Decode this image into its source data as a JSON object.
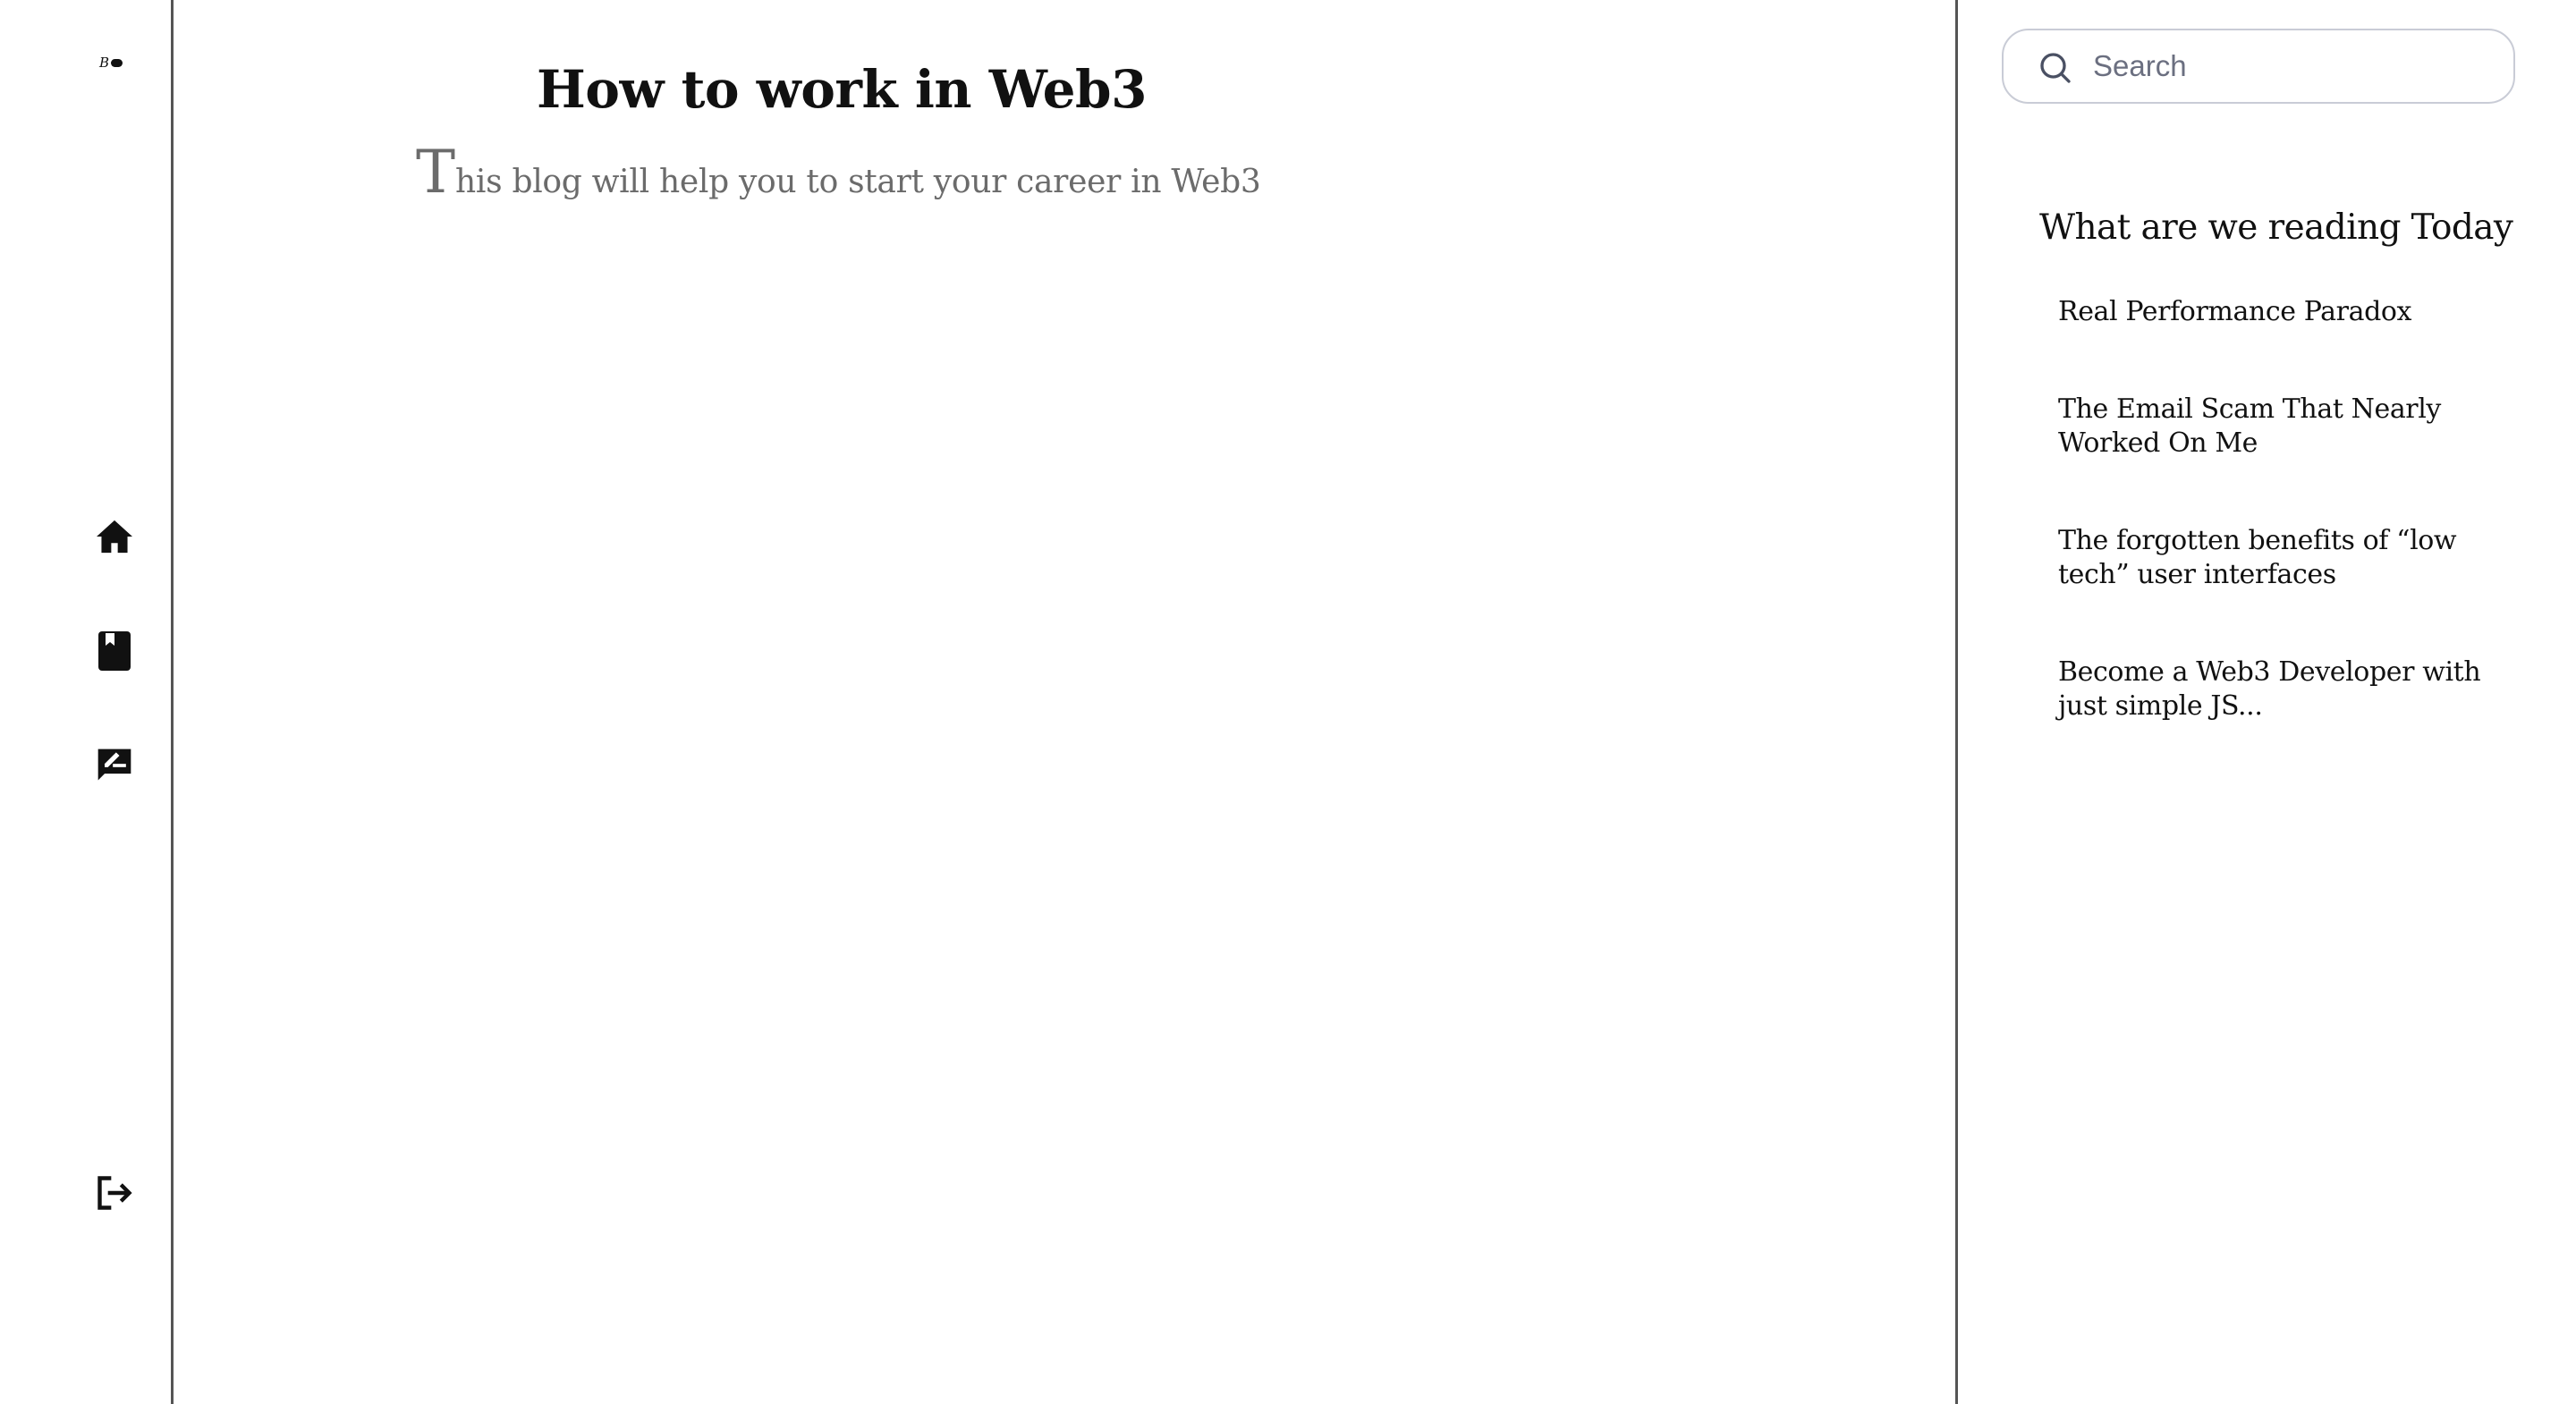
{
  "logo": {
    "letter": "B"
  },
  "sidebar": {
    "icons": [
      "home-icon",
      "book-icon",
      "write-review-icon",
      "logout-icon"
    ]
  },
  "post": {
    "title": "How to work in Web3",
    "subtitle_dropcap": "T",
    "subtitle_rest": "his blog will help you to start your career in Web3"
  },
  "search": {
    "placeholder": "Search",
    "value": ""
  },
  "reading": {
    "heading": "What are we reading Today",
    "items": [
      {
        "title": "Real Performance Paradox"
      },
      {
        "title": "The Email Scam That Nearly Worked On Me"
      },
      {
        "title": "The forgotten benefits of “low tech” user interfaces"
      },
      {
        "title": "Become a Web3 Developer with just simple JS..."
      }
    ]
  },
  "colors": {
    "divider": "#555555",
    "text": "#111111",
    "muted_text": "#6b6b6b",
    "search_border": "#c9ccd6"
  }
}
